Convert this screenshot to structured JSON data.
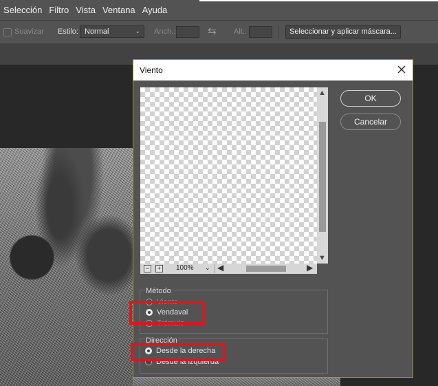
{
  "menu": [
    "Selección",
    "Filtro",
    "Vista",
    "Ventana",
    "Ayuda"
  ],
  "options": {
    "smooth_label": "Suavizar",
    "style_label": "Estilo:",
    "style_value": "Normal",
    "width_label": "Anch.:",
    "height_label": "Alt.:",
    "mask_button": "Seleccionar y aplicar máscara..."
  },
  "dialog": {
    "title": "Viento",
    "ok": "OK",
    "cancel": "Cancelar",
    "zoom": "100%",
    "method": {
      "label": "Método",
      "options": [
        "Viento",
        "Vendaval",
        "Trémulo"
      ],
      "selected": "Vendaval"
    },
    "direction": {
      "label": "Dirección",
      "options": [
        "Desde la derecha",
        "Desde la izquierda"
      ],
      "selected": "Desde la derecha"
    }
  },
  "colors": {
    "highlight": "#d11b24",
    "dialog_border": "#9c9830",
    "panel": "#535353"
  }
}
